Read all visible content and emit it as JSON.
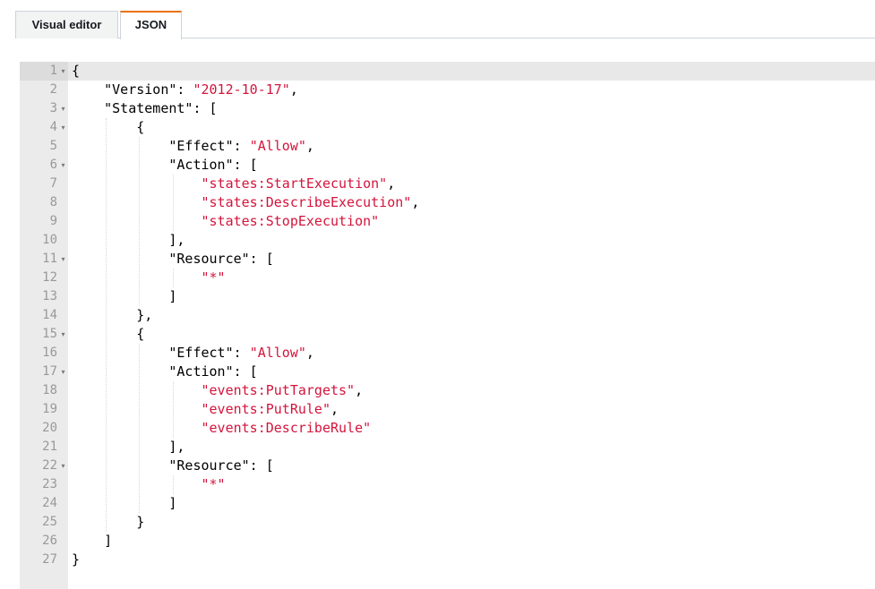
{
  "tabs": [
    {
      "label": "Visual editor",
      "active": false
    },
    {
      "label": "JSON",
      "active": true
    }
  ],
  "colors": {
    "active_tab_accent": "#ec7211",
    "string_color": "#d4143c",
    "gutter_bg": "#ebebeb"
  },
  "editor": {
    "line_numbers": [
      "1",
      "2",
      "3",
      "4",
      "5",
      "6",
      "7",
      "8",
      "9",
      "10",
      "11",
      "12",
      "13",
      "14",
      "15",
      "16",
      "17",
      "18",
      "19",
      "20",
      "21",
      "22",
      "23",
      "24",
      "25",
      "26",
      "27"
    ],
    "fold_markers": [
      1,
      3,
      4,
      6,
      11,
      15,
      17,
      22
    ],
    "active_line": 1,
    "lines": [
      [
        {
          "t": "{"
        }
      ],
      [
        {
          "t": "    \"Version\": "
        },
        {
          "t": "\"2012-10-17\"",
          "s": 1
        },
        {
          "t": ","
        }
      ],
      [
        {
          "t": "    \"Statement\": ["
        }
      ],
      [
        {
          "t": "        {"
        }
      ],
      [
        {
          "t": "            \"Effect\": "
        },
        {
          "t": "\"Allow\"",
          "s": 1
        },
        {
          "t": ","
        }
      ],
      [
        {
          "t": "            \"Action\": ["
        }
      ],
      [
        {
          "t": "                "
        },
        {
          "t": "\"states:StartExecution\"",
          "s": 1
        },
        {
          "t": ","
        }
      ],
      [
        {
          "t": "                "
        },
        {
          "t": "\"states:DescribeExecution\"",
          "s": 1
        },
        {
          "t": ","
        }
      ],
      [
        {
          "t": "                "
        },
        {
          "t": "\"states:StopExecution\"",
          "s": 1
        }
      ],
      [
        {
          "t": "            ],"
        }
      ],
      [
        {
          "t": "            \"Resource\": ["
        }
      ],
      [
        {
          "t": "                "
        },
        {
          "t": "\"*\"",
          "s": 1
        }
      ],
      [
        {
          "t": "            ]"
        }
      ],
      [
        {
          "t": "        },"
        }
      ],
      [
        {
          "t": "        {"
        }
      ],
      [
        {
          "t": "            \"Effect\": "
        },
        {
          "t": "\"Allow\"",
          "s": 1
        },
        {
          "t": ","
        }
      ],
      [
        {
          "t": "            \"Action\": ["
        }
      ],
      [
        {
          "t": "                "
        },
        {
          "t": "\"events:PutTargets\"",
          "s": 1
        },
        {
          "t": ","
        }
      ],
      [
        {
          "t": "                "
        },
        {
          "t": "\"events:PutRule\"",
          "s": 1
        },
        {
          "t": ","
        }
      ],
      [
        {
          "t": "                "
        },
        {
          "t": "\"events:DescribeRule\"",
          "s": 1
        }
      ],
      [
        {
          "t": "            ],"
        }
      ],
      [
        {
          "t": "            \"Resource\": ["
        }
      ],
      [
        {
          "t": "                "
        },
        {
          "t": "\"*\"",
          "s": 1
        }
      ],
      [
        {
          "t": "            ]"
        }
      ],
      [
        {
          "t": "        }"
        }
      ],
      [
        {
          "t": "    ]"
        }
      ],
      [
        {
          "t": "}"
        }
      ]
    ]
  }
}
